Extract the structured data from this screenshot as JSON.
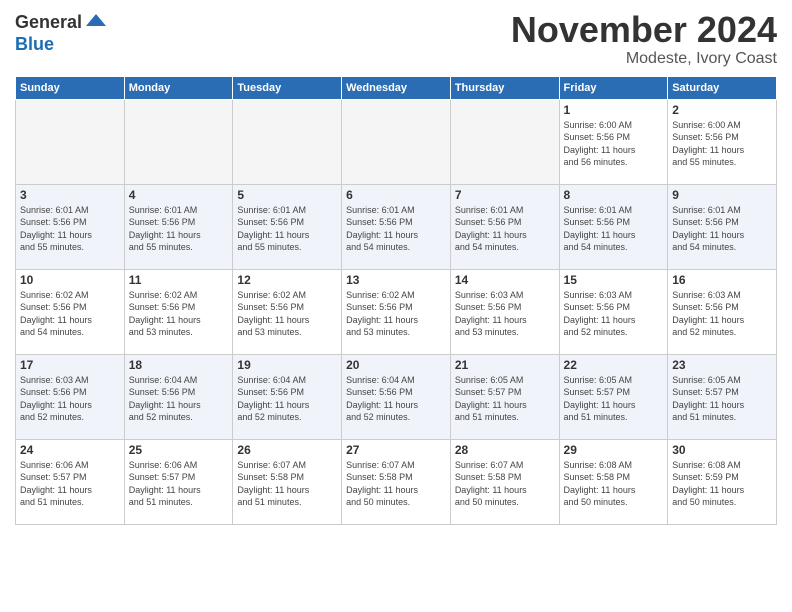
{
  "header": {
    "logo_general": "General",
    "logo_blue": "Blue",
    "month_title": "November 2024",
    "subtitle": "Modeste, Ivory Coast"
  },
  "days_of_week": [
    "Sunday",
    "Monday",
    "Tuesday",
    "Wednesday",
    "Thursday",
    "Friday",
    "Saturday"
  ],
  "weeks": [
    {
      "shade": false,
      "days": [
        {
          "num": "",
          "info": "",
          "empty": true
        },
        {
          "num": "",
          "info": "",
          "empty": true
        },
        {
          "num": "",
          "info": "",
          "empty": true
        },
        {
          "num": "",
          "info": "",
          "empty": true
        },
        {
          "num": "",
          "info": "",
          "empty": true
        },
        {
          "num": "1",
          "info": "Sunrise: 6:00 AM\nSunset: 5:56 PM\nDaylight: 11 hours\nand 56 minutes."
        },
        {
          "num": "2",
          "info": "Sunrise: 6:00 AM\nSunset: 5:56 PM\nDaylight: 11 hours\nand 55 minutes."
        }
      ]
    },
    {
      "shade": true,
      "days": [
        {
          "num": "3",
          "info": "Sunrise: 6:01 AM\nSunset: 5:56 PM\nDaylight: 11 hours\nand 55 minutes."
        },
        {
          "num": "4",
          "info": "Sunrise: 6:01 AM\nSunset: 5:56 PM\nDaylight: 11 hours\nand 55 minutes."
        },
        {
          "num": "5",
          "info": "Sunrise: 6:01 AM\nSunset: 5:56 PM\nDaylight: 11 hours\nand 55 minutes."
        },
        {
          "num": "6",
          "info": "Sunrise: 6:01 AM\nSunset: 5:56 PM\nDaylight: 11 hours\nand 54 minutes."
        },
        {
          "num": "7",
          "info": "Sunrise: 6:01 AM\nSunset: 5:56 PM\nDaylight: 11 hours\nand 54 minutes."
        },
        {
          "num": "8",
          "info": "Sunrise: 6:01 AM\nSunset: 5:56 PM\nDaylight: 11 hours\nand 54 minutes."
        },
        {
          "num": "9",
          "info": "Sunrise: 6:01 AM\nSunset: 5:56 PM\nDaylight: 11 hours\nand 54 minutes."
        }
      ]
    },
    {
      "shade": false,
      "days": [
        {
          "num": "10",
          "info": "Sunrise: 6:02 AM\nSunset: 5:56 PM\nDaylight: 11 hours\nand 54 minutes."
        },
        {
          "num": "11",
          "info": "Sunrise: 6:02 AM\nSunset: 5:56 PM\nDaylight: 11 hours\nand 53 minutes."
        },
        {
          "num": "12",
          "info": "Sunrise: 6:02 AM\nSunset: 5:56 PM\nDaylight: 11 hours\nand 53 minutes."
        },
        {
          "num": "13",
          "info": "Sunrise: 6:02 AM\nSunset: 5:56 PM\nDaylight: 11 hours\nand 53 minutes."
        },
        {
          "num": "14",
          "info": "Sunrise: 6:03 AM\nSunset: 5:56 PM\nDaylight: 11 hours\nand 53 minutes."
        },
        {
          "num": "15",
          "info": "Sunrise: 6:03 AM\nSunset: 5:56 PM\nDaylight: 11 hours\nand 52 minutes."
        },
        {
          "num": "16",
          "info": "Sunrise: 6:03 AM\nSunset: 5:56 PM\nDaylight: 11 hours\nand 52 minutes."
        }
      ]
    },
    {
      "shade": true,
      "days": [
        {
          "num": "17",
          "info": "Sunrise: 6:03 AM\nSunset: 5:56 PM\nDaylight: 11 hours\nand 52 minutes."
        },
        {
          "num": "18",
          "info": "Sunrise: 6:04 AM\nSunset: 5:56 PM\nDaylight: 11 hours\nand 52 minutes."
        },
        {
          "num": "19",
          "info": "Sunrise: 6:04 AM\nSunset: 5:56 PM\nDaylight: 11 hours\nand 52 minutes."
        },
        {
          "num": "20",
          "info": "Sunrise: 6:04 AM\nSunset: 5:56 PM\nDaylight: 11 hours\nand 52 minutes."
        },
        {
          "num": "21",
          "info": "Sunrise: 6:05 AM\nSunset: 5:57 PM\nDaylight: 11 hours\nand 51 minutes."
        },
        {
          "num": "22",
          "info": "Sunrise: 6:05 AM\nSunset: 5:57 PM\nDaylight: 11 hours\nand 51 minutes."
        },
        {
          "num": "23",
          "info": "Sunrise: 6:05 AM\nSunset: 5:57 PM\nDaylight: 11 hours\nand 51 minutes."
        }
      ]
    },
    {
      "shade": false,
      "days": [
        {
          "num": "24",
          "info": "Sunrise: 6:06 AM\nSunset: 5:57 PM\nDaylight: 11 hours\nand 51 minutes."
        },
        {
          "num": "25",
          "info": "Sunrise: 6:06 AM\nSunset: 5:57 PM\nDaylight: 11 hours\nand 51 minutes."
        },
        {
          "num": "26",
          "info": "Sunrise: 6:07 AM\nSunset: 5:58 PM\nDaylight: 11 hours\nand 51 minutes."
        },
        {
          "num": "27",
          "info": "Sunrise: 6:07 AM\nSunset: 5:58 PM\nDaylight: 11 hours\nand 50 minutes."
        },
        {
          "num": "28",
          "info": "Sunrise: 6:07 AM\nSunset: 5:58 PM\nDaylight: 11 hours\nand 50 minutes."
        },
        {
          "num": "29",
          "info": "Sunrise: 6:08 AM\nSunset: 5:58 PM\nDaylight: 11 hours\nand 50 minutes."
        },
        {
          "num": "30",
          "info": "Sunrise: 6:08 AM\nSunset: 5:59 PM\nDaylight: 11 hours\nand 50 minutes."
        }
      ]
    }
  ]
}
